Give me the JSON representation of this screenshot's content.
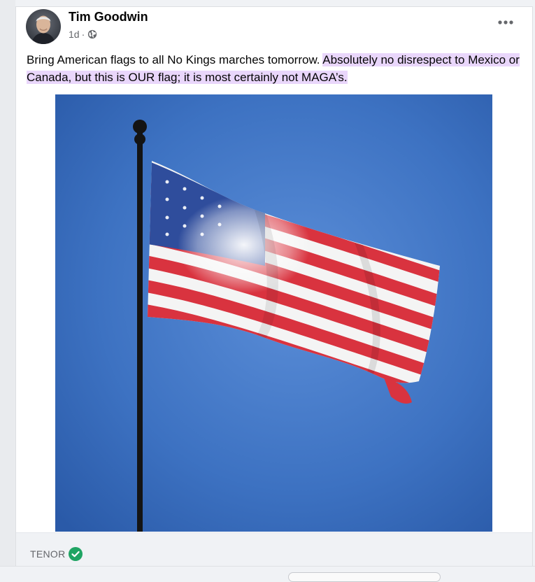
{
  "post": {
    "author": "Tim Goodwin",
    "timestamp": "1d",
    "separator": "·",
    "privacy_icon": "globe-icon",
    "more_icon": "more-horizontal-icon",
    "text_plain": "Bring American flags to all No Kings marches tomorrow. ",
    "text_highlighted": "Absolutely no disrespect to Mexico or Canada, but this is OUR flag; it is most certainly not MAGA’s."
  },
  "media": {
    "type": "gif",
    "provider": "TENOR",
    "provider_badge_icon": "verified-check-icon"
  },
  "colors": {
    "highlight": "#e9d6fb",
    "verified": "#1fa463",
    "sky": "#2f64b4"
  }
}
